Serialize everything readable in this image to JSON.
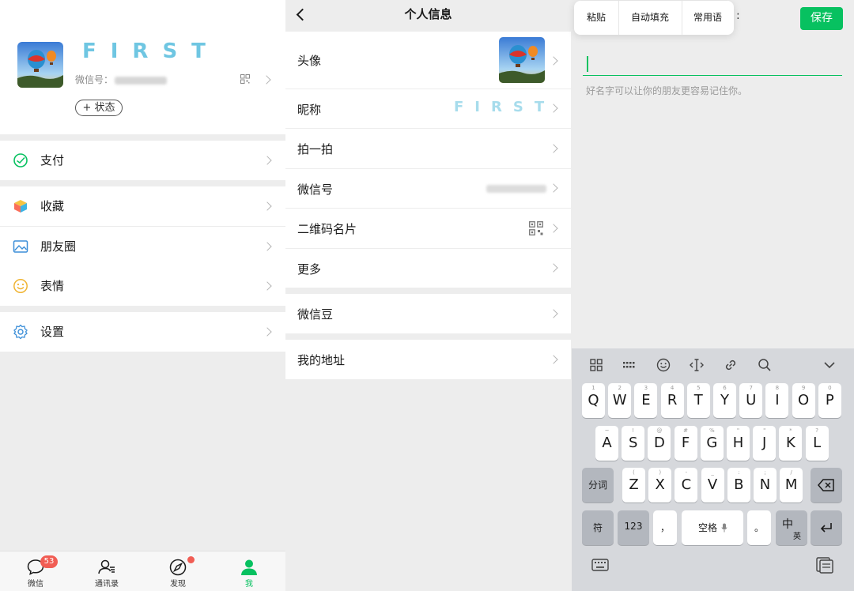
{
  "me": {
    "nickname": "FIRST",
    "wechat_id_label": "微信号：",
    "status_button": "+ 状态"
  },
  "menu": [
    {
      "label": "支付",
      "icon": "pay-icon"
    },
    {
      "label": "收藏",
      "icon": "favorites-icon"
    },
    {
      "label": "朋友圈",
      "icon": "moments-icon"
    },
    {
      "label": "表情",
      "icon": "sticker-icon"
    },
    {
      "label": "设置",
      "icon": "settings-icon"
    }
  ],
  "tabbar": [
    {
      "label": "微信",
      "icon": "chat-icon",
      "badge": "53"
    },
    {
      "label": "通讯录",
      "icon": "contacts-icon"
    },
    {
      "label": "发现",
      "icon": "discover-icon"
    },
    {
      "label": "我",
      "icon": "me-icon"
    }
  ],
  "profile": {
    "title": "个人信息",
    "rows": [
      "头像",
      "昵称",
      "拍一拍",
      "微信号",
      "二维码名片",
      "更多",
      "微信豆",
      "我的地址"
    ],
    "nickname": "FIRST"
  },
  "edit": {
    "save": "保存",
    "popup": [
      "粘贴",
      "自动填充",
      "常用语"
    ],
    "hint": "好名字可以让你的朋友更容易记住你。"
  },
  "keyboard": {
    "row1": [
      {
        "k": "Q",
        "s": "1"
      },
      {
        "k": "W",
        "s": "2"
      },
      {
        "k": "E",
        "s": "3"
      },
      {
        "k": "R",
        "s": "4"
      },
      {
        "k": "T",
        "s": "5"
      },
      {
        "k": "Y",
        "s": "6"
      },
      {
        "k": "U",
        "s": "7"
      },
      {
        "k": "I",
        "s": "8"
      },
      {
        "k": "O",
        "s": "9"
      },
      {
        "k": "P",
        "s": "0"
      }
    ],
    "row2": [
      {
        "k": "A",
        "s": "~"
      },
      {
        "k": "S",
        "s": "!"
      },
      {
        "k": "D",
        "s": "@"
      },
      {
        "k": "F",
        "s": "#"
      },
      {
        "k": "G",
        "s": "%"
      },
      {
        "k": "H",
        "s": "\""
      },
      {
        "k": "J",
        "s": "\""
      },
      {
        "k": "K",
        "s": "*"
      },
      {
        "k": "L",
        "s": "?"
      }
    ],
    "row3": [
      {
        "k": "Z",
        "s": "("
      },
      {
        "k": "X",
        "s": ")"
      },
      {
        "k": "C",
        "s": "-"
      },
      {
        "k": "V",
        "s": "_"
      },
      {
        "k": "B",
        "s": ":"
      },
      {
        "k": "N",
        "s": ";"
      },
      {
        "k": "M",
        "s": "/"
      }
    ],
    "split": "分词",
    "symbol": "符",
    "num": "123",
    "comma": "，",
    "space": "空格",
    "period": "。",
    "lang_main": "中",
    "lang_sub": "英"
  },
  "colors": {
    "accent": "#07c160",
    "nickname": "#6fc6e2",
    "badge": "#f15d54"
  }
}
